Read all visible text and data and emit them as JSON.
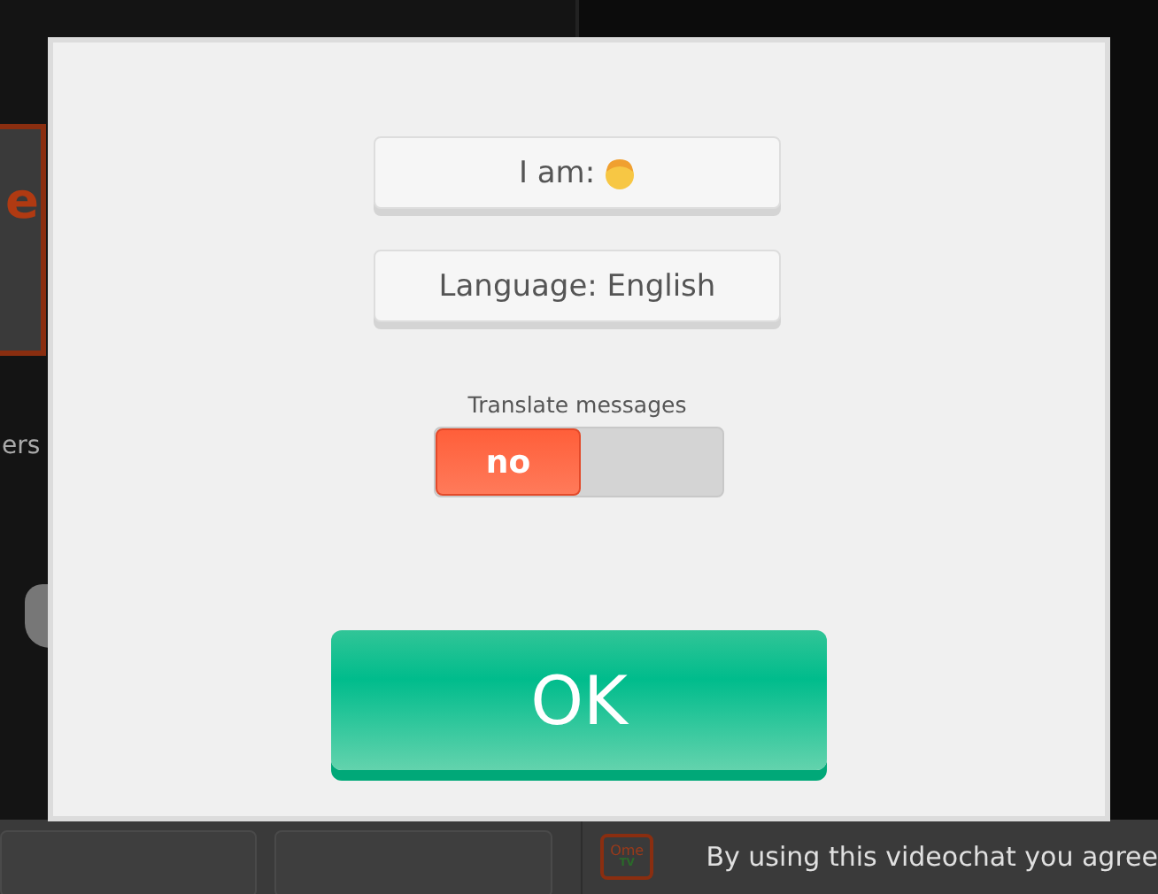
{
  "background": {
    "logo_fragment": "e",
    "caption_fragment": "ers",
    "footer": {
      "tv_logo": {
        "line1": "Ome",
        "line2": "TV"
      },
      "notice": "By using this videochat you agree"
    }
  },
  "dialog": {
    "gender_button": {
      "label": "I am:"
    },
    "language_button": {
      "label": "Language: English"
    },
    "translate": {
      "label": "Translate messages",
      "value": "no",
      "on": false
    },
    "ok_button": {
      "label": "OK"
    }
  }
}
